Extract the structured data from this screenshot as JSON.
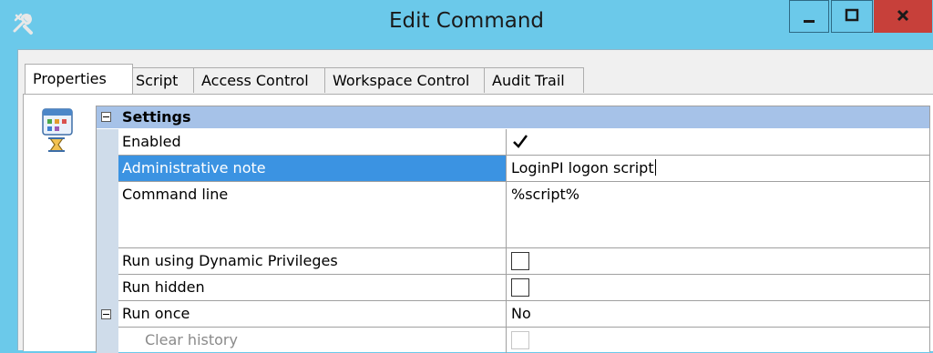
{
  "window": {
    "title": "Edit Command",
    "controls": {
      "minimize": "minimize",
      "maximize": "maximize",
      "close": "close"
    }
  },
  "tabs": [
    {
      "label": "Properties",
      "active": true
    },
    {
      "label": "Script",
      "active": false
    },
    {
      "label": "Access Control",
      "active": false
    },
    {
      "label": "Workspace Control",
      "active": false
    },
    {
      "label": "Audit Trail",
      "active": false
    }
  ],
  "grid": {
    "section": "Settings",
    "rows": [
      {
        "name": "Enabled",
        "type": "checkbox",
        "checked": true
      },
      {
        "name": "Administrative note",
        "type": "text",
        "value": "LoginPI logon script",
        "selected": true
      },
      {
        "name": "Command line",
        "type": "text",
        "value": "%script%"
      },
      {
        "name": "Run using Dynamic Privileges",
        "type": "checkbox",
        "checked": false
      },
      {
        "name": "Run hidden",
        "type": "checkbox",
        "checked": false
      },
      {
        "name": "Run once",
        "type": "text",
        "value": "No",
        "expandable": true
      },
      {
        "name": "Clear history",
        "type": "checkbox",
        "checked": false,
        "disabled": true
      }
    ]
  },
  "colors": {
    "titlebar": "#6bc9ea",
    "close_button": "#c7403a",
    "selection": "#3b93e2",
    "section_header": "#a6c2e8"
  },
  "icons": {
    "app": "tools-icon",
    "panel": "command-window-icon"
  }
}
